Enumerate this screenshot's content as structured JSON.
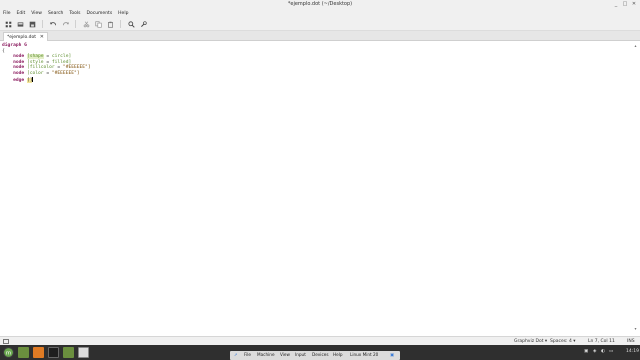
{
  "window": {
    "title": "*ejemplo.dot (~/Desktop)",
    "controls": [
      "_",
      "□",
      "✕"
    ]
  },
  "menu": [
    "File",
    "Edit",
    "View",
    "Search",
    "Tools",
    "Documents",
    "Help"
  ],
  "toolbar": {
    "icons": [
      "new-document-icon",
      "open-icon",
      "save-icon",
      "undo-icon",
      "redo-icon",
      "cut-icon",
      "copy-icon",
      "paste-icon",
      "search-icon",
      "tools-icon"
    ]
  },
  "tab": {
    "label": "*ejemplo.dot",
    "close": "✕"
  },
  "code": {
    "line1": "digraph G",
    "line2": "{",
    "line3_kw": "node",
    "line3_attr": "[shape",
    "line3_eq": " = ",
    "line3_val": "circle]",
    "line4_kw": "node",
    "line4_attr": "[style",
    "line4_eq": " = ",
    "line4_val": "filled]",
    "line5_kw": "node",
    "line5_attr": "[fillcolor",
    "line5_eq": " = ",
    "line5_val": "\"#EEEEEE\"]",
    "line6_kw": "node",
    "line6_attr": "[color",
    "line6_eq": " = ",
    "line6_val": "\"#EEEEEE\"]",
    "line7_kw": "edge",
    "line7_rest": "[]"
  },
  "status": {
    "language": "Graphviz Dot ▾",
    "spaces": "Spaces: 4 ▾",
    "position": "Ln 7, Col 11",
    "mode": "INS"
  },
  "vm_menu": [
    "File",
    "Machine",
    "View",
    "Input",
    "Devices",
    "Help",
    "Linux Mint 20"
  ],
  "tray": {
    "time": "14:19"
  }
}
